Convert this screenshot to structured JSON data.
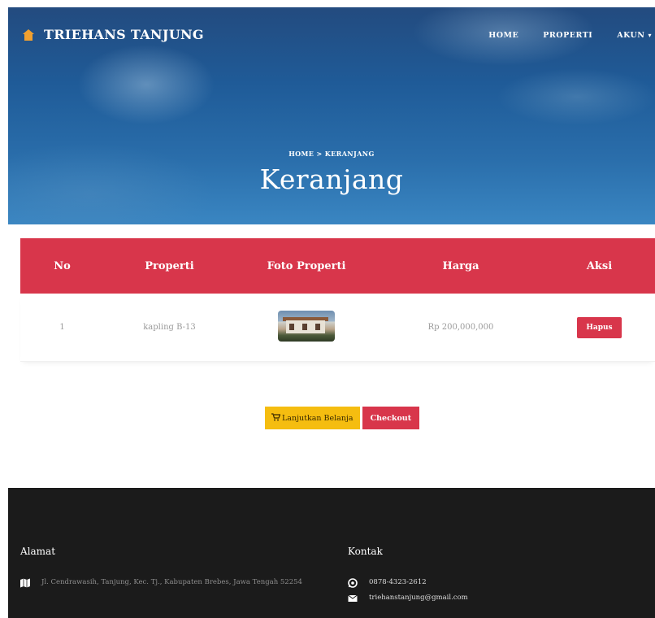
{
  "brand": {
    "name": "TRIEHANS TANJUNG",
    "icon": "house-icon",
    "icon_color": "#f0a030"
  },
  "nav": {
    "home": "HOME",
    "properti": "PROPERTI",
    "akun": "AKUN"
  },
  "breadcrumb": {
    "home": "HOME",
    "separator": ">",
    "current": "KERANJANG"
  },
  "page_title": "Keranjang",
  "table": {
    "headers": [
      "No",
      "Properti",
      "Foto Properti",
      "Harga",
      "Aksi"
    ],
    "rows": [
      {
        "no": "1",
        "properti": "kapling B-13",
        "foto": "property-photo",
        "harga": "Rp 200,000,000",
        "aksi": "Hapus"
      }
    ]
  },
  "actions": {
    "continue_label": "Lanjutkan Belanja",
    "checkout_label": "Checkout"
  },
  "footer": {
    "alamat_title": "Alamat",
    "alamat_text": "Jl. Cendrawasih, Tanjung, Kec. Tj., Kabupaten Brebes, Jawa Tengah 52254",
    "kontak_title": "Kontak",
    "phone": "0878-4323-2612",
    "email": "triehanstanjung@gmail.com"
  },
  "colors": {
    "accent_red": "#d8364b",
    "accent_yellow": "#f5bd10",
    "footer_bg": "#1b1b1b"
  }
}
